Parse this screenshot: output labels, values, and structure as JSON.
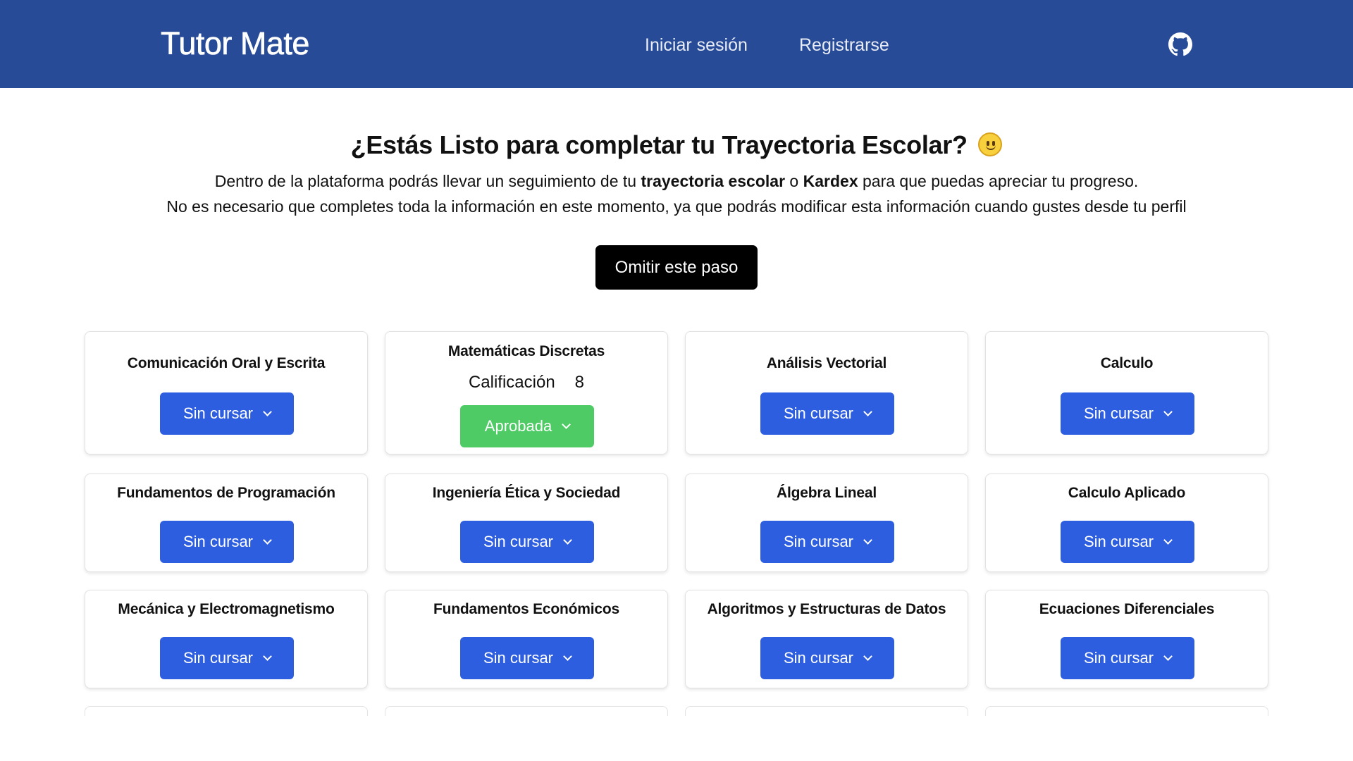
{
  "nav": {
    "brand": "Tutor Mate",
    "login": "Iniciar sesión",
    "register": "Registrarse",
    "github_icon": "github-icon",
    "background": "#274b96"
  },
  "intro": {
    "title": "¿Estás Listo para completar tu Trayectoria Escolar?",
    "emoji_icon": "slightly-smiling-face-icon",
    "line1_before": "Dentro de la plataforma podrás llevar un seguimiento de tu ",
    "line1_bold1": "trayectoria escolar",
    "line1_mid": " o ",
    "line1_bold2": "Kardex",
    "line1_after": " para que puedas apreciar tu progreso.",
    "line2": "No es necesario que completes toda la información en este momento, ya que podrás modificar esta información cuando gustes desde tu perfil",
    "skip_button": "Omitir este paso"
  },
  "colors": {
    "status_pending": "#2e5ee0",
    "status_approved": "#4fcb66"
  },
  "subjects": [
    {
      "name": "Comunicación Oral y Escrita",
      "status": "Sin cursar"
    },
    {
      "name": "Matemáticas Discretas",
      "grade_label": "Calificación",
      "grade": "8",
      "status": "Aprobada"
    },
    {
      "name": "Análisis Vectorial",
      "status": "Sin cursar"
    },
    {
      "name": "Calculo",
      "status": "Sin cursar"
    },
    {
      "name": "Fundamentos de Programación",
      "status": "Sin cursar"
    },
    {
      "name": "Ingeniería Ética y Sociedad",
      "status": "Sin cursar"
    },
    {
      "name": "Álgebra Lineal",
      "status": "Sin cursar"
    },
    {
      "name": "Calculo Aplicado",
      "status": "Sin cursar"
    },
    {
      "name": "Mecánica y Electromagnetismo",
      "status": "Sin cursar"
    },
    {
      "name": "Fundamentos Económicos",
      "status": "Sin cursar"
    },
    {
      "name": "Algoritmos y Estructuras de Datos",
      "status": "Sin cursar"
    },
    {
      "name": "Ecuaciones Diferenciales",
      "status": "Sin cursar"
    }
  ]
}
